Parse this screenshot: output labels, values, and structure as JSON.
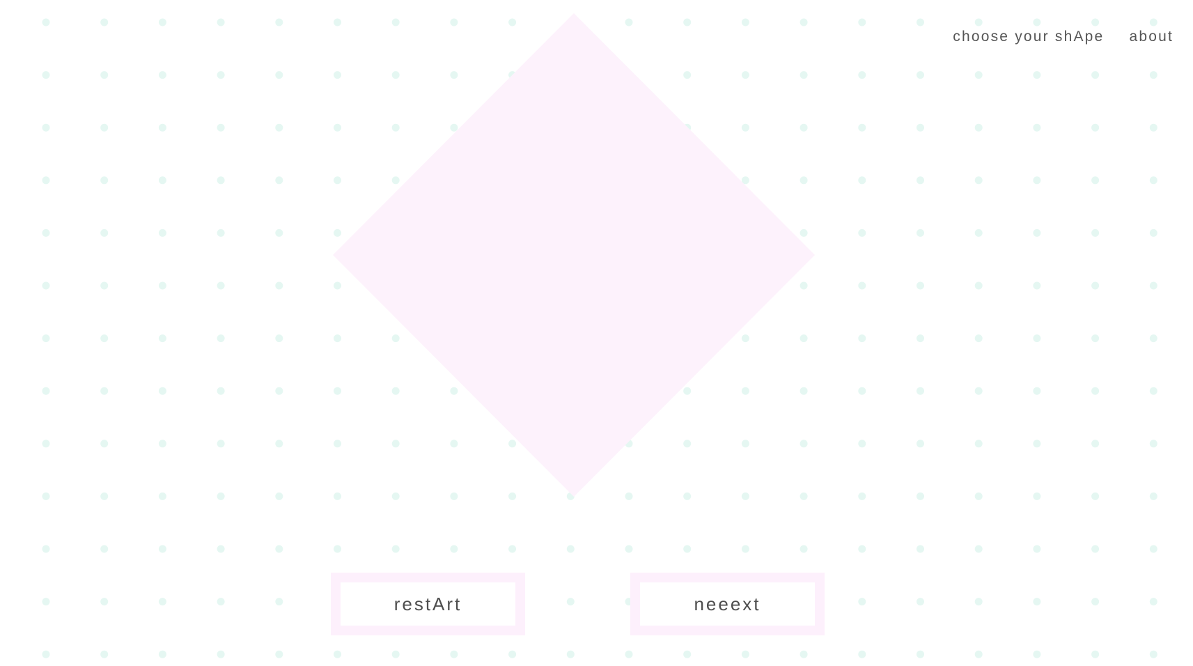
{
  "nav": {
    "items": [
      {
        "label": "choose your shApe"
      },
      {
        "label": "about"
      }
    ]
  },
  "shape": {
    "name": "diamond",
    "fill": "#fdf2fc"
  },
  "buttons": {
    "restart_label": "restArt",
    "next_label": "neeext",
    "border_color": "#fdf0fc"
  },
  "colors": {
    "background": "#ffffff",
    "dot": "#e5f7f2",
    "text": "#555555"
  }
}
